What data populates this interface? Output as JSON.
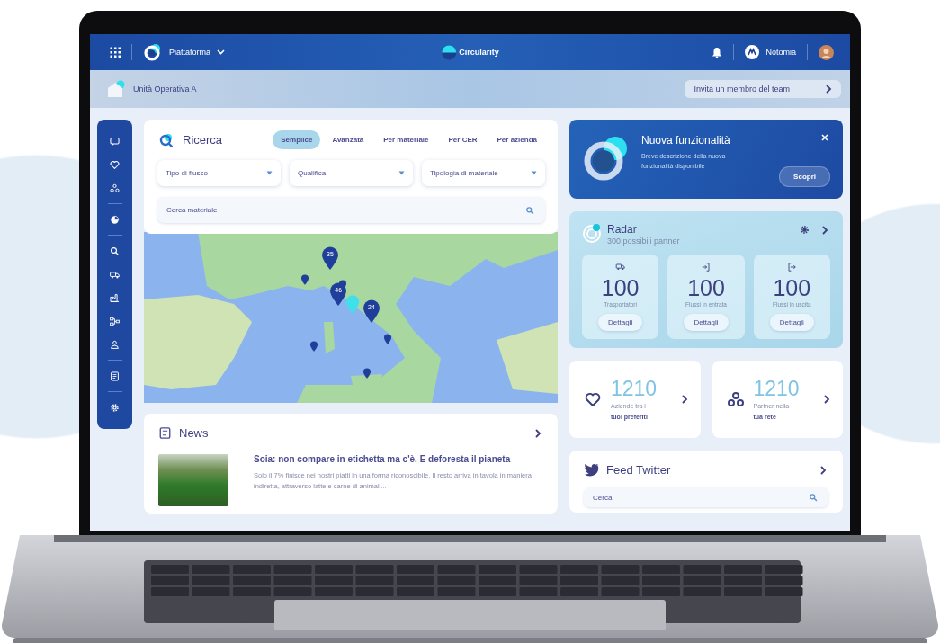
{
  "topbar": {
    "menu": "Piattaforma",
    "brand": "Circularity",
    "org": "Notomia"
  },
  "subbar": {
    "unit": "Unità Operativa A",
    "invite": "Invita un membro del team"
  },
  "search": {
    "title": "Ricerca",
    "tabs": [
      {
        "label": "Semplice",
        "selected": true
      },
      {
        "label": "Avanzata",
        "selected": false
      },
      {
        "label": "Per materiale",
        "selected": false
      },
      {
        "label": "Per CER",
        "selected": false
      },
      {
        "label": "Per azienda",
        "selected": false
      }
    ],
    "filters": [
      {
        "label": "Tipo di flusso"
      },
      {
        "label": "Qualifica"
      },
      {
        "label": "Tipologia di materiale"
      }
    ],
    "query": {
      "placeholder": "Cerca materiale"
    }
  },
  "map": {
    "pins": [
      {
        "kind": "cluster",
        "count": "35"
      },
      {
        "kind": "cluster",
        "count": "46"
      },
      {
        "kind": "cluster",
        "count": "24"
      },
      {
        "kind": "current"
      },
      {
        "kind": "single"
      },
      {
        "kind": "single"
      },
      {
        "kind": "single"
      },
      {
        "kind": "single"
      },
      {
        "kind": "single"
      }
    ]
  },
  "news": {
    "title": "News",
    "items": [
      {
        "headline": "Soia: non compare in etichetta ma c'è. E deforesta il pianeta",
        "summary": "Solo il 7% finisce nei nostri piatti in una forma riconoscibile. Il resto arriva in tavola in maniera indiretta, attraverso latte e carne di animali..."
      }
    ]
  },
  "feature": {
    "title": "Nuova funzionalità",
    "description": "Breve descrizione della nuova funzionalità disponibile",
    "action": "Scopri"
  },
  "radar": {
    "title": "Radar",
    "subtitle": "300 possibili partner",
    "stats": [
      {
        "kind": "carriers",
        "value": "100",
        "label": "Trasportatori",
        "action": "Dettagli"
      },
      {
        "kind": "inbound",
        "value": "100",
        "label": "Flussi in entrata",
        "action": "Dettagli"
      },
      {
        "kind": "outbound",
        "value": "100",
        "label": "Flussi in uscita",
        "action": "Dettagli"
      }
    ]
  },
  "counters": [
    {
      "kind": "favorites",
      "value": "1210",
      "label": "Aziende tra i",
      "emphasis": "tuoi preferiti"
    },
    {
      "kind": "network",
      "value": "1210",
      "label": "Partner nella",
      "emphasis": "tua rete"
    }
  ],
  "twitter": {
    "title": "Feed Twitter",
    "search": {
      "placeholder": "Cerca"
    }
  }
}
